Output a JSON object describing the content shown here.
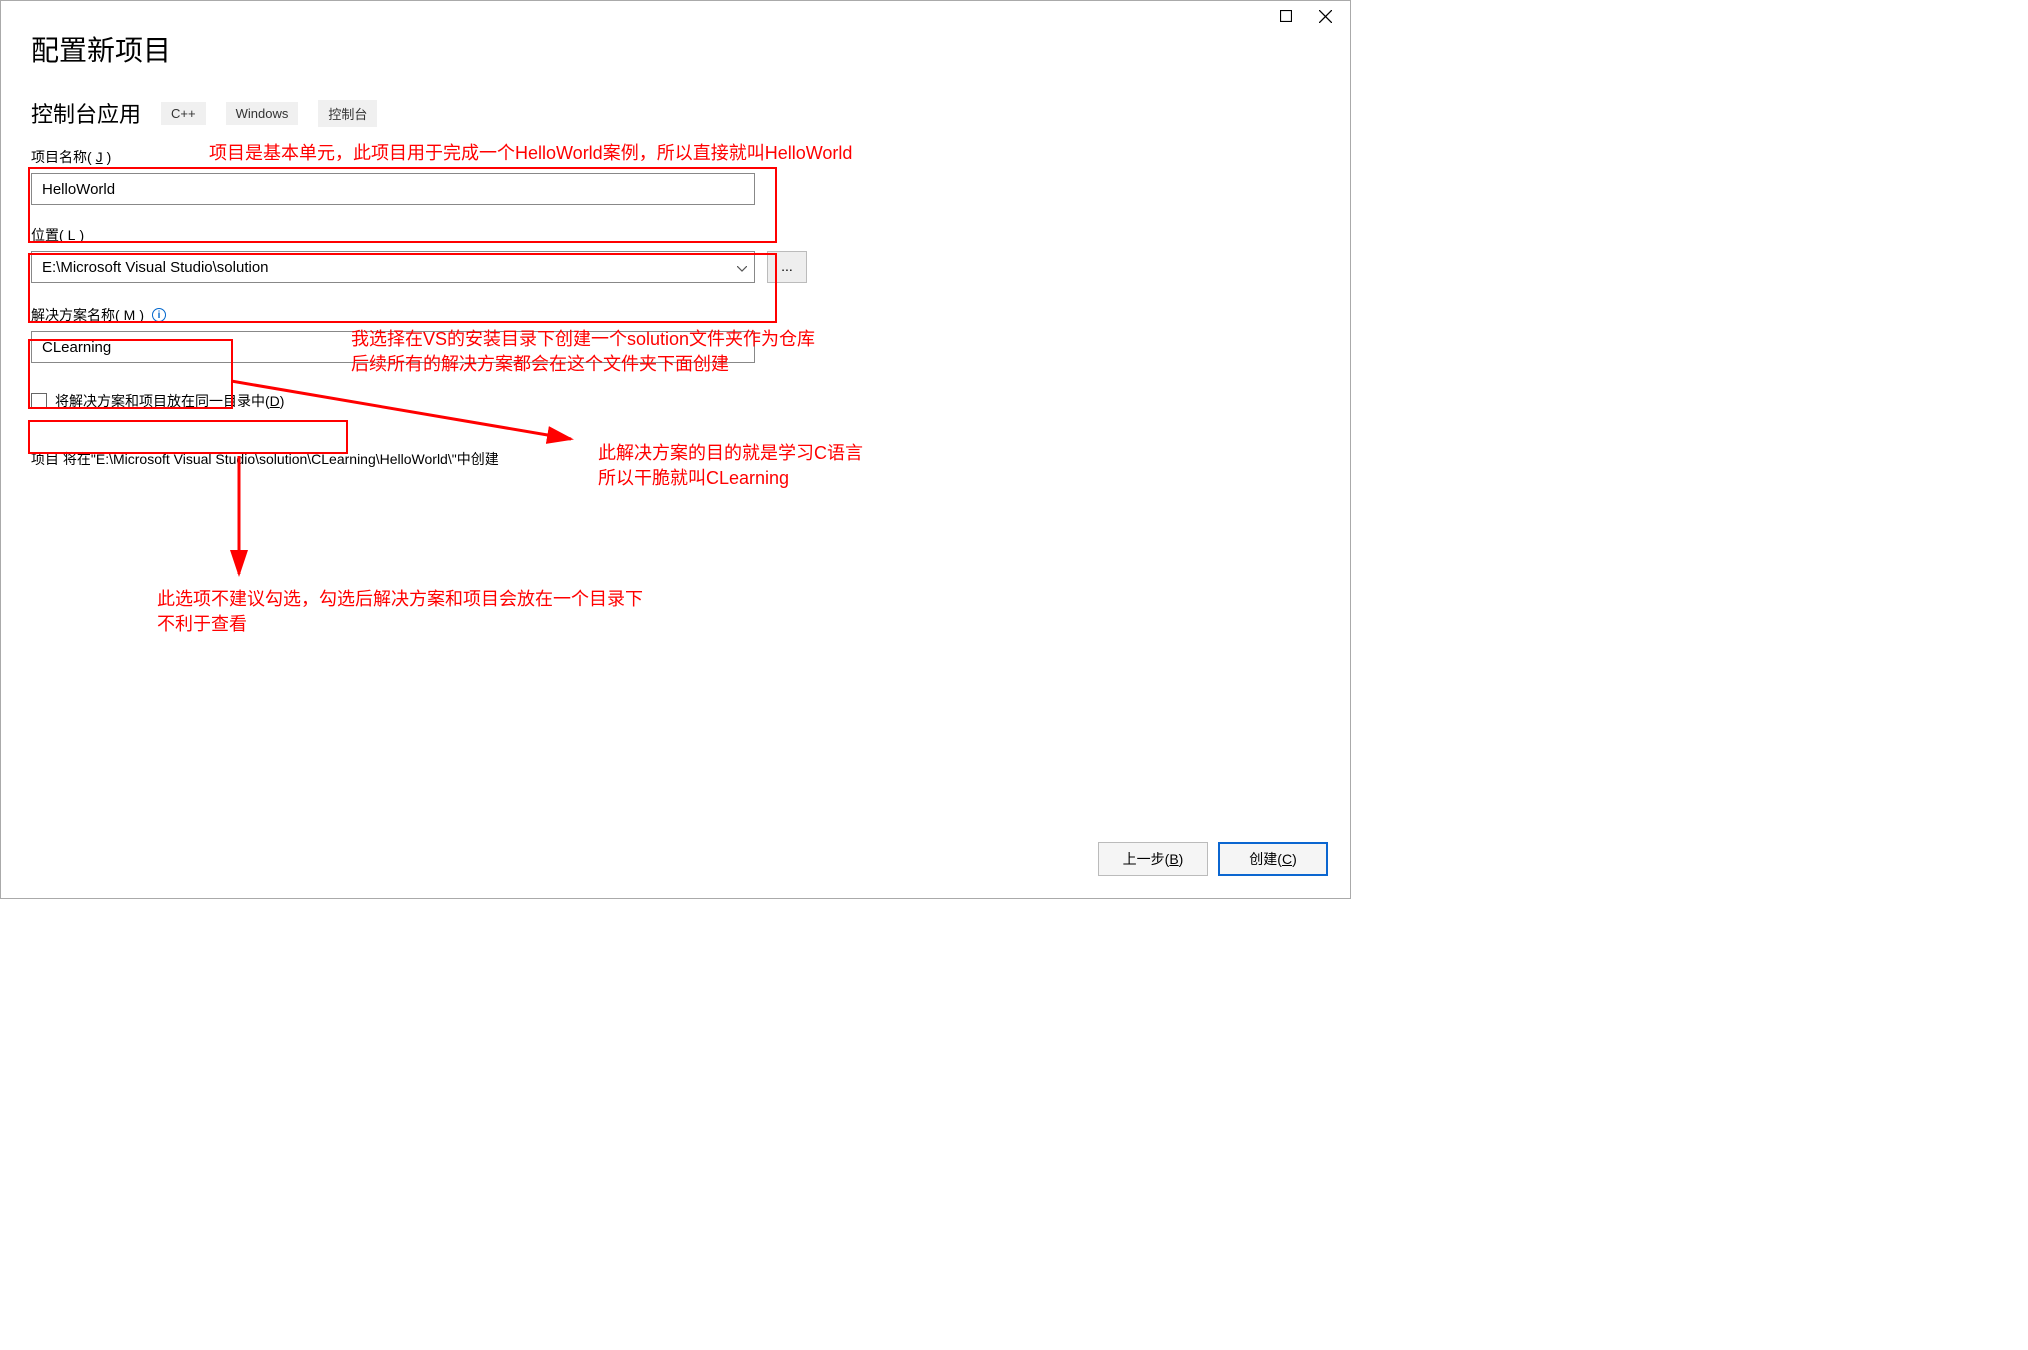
{
  "heading": "配置新项目",
  "subtitle": "控制台应用",
  "tags": [
    "C++",
    "Windows",
    "控制台"
  ],
  "annotations": {
    "a1": "项目是基本单元，此项目用于完成一个HelloWorld案例，所以直接就叫HelloWorld",
    "a2": "我选择在VS的安装目录下创建一个solution文件夹作为仓库\n后续所有的解决方案都会在这个文件夹下面创建",
    "a3": "此解决方案的目的就是学习C语言\n所以干脆就叫CLearning",
    "a4": "此选项不建议勾选，勾选后解决方案和项目会放在一个目录下\n不利于查看"
  },
  "labels": {
    "projectName": "项目名称(J)",
    "location": "位置(L)",
    "solutionName": "解决方案名称(M)",
    "checkbox": "将解决方案和项目放在同一目录中(D)"
  },
  "values": {
    "projectName": "HelloWorld",
    "location": "E:\\Microsoft Visual Studio\\solution",
    "solutionName": "CLearning",
    "browse": "..."
  },
  "pathText": "项目 将在\"E:\\Microsoft Visual Studio\\solution\\CLearning\\HelloWorld\\\"中创建",
  "buttons": {
    "back": "上一步(B)",
    "create": "创建(C)"
  },
  "infoGlyph": "i"
}
